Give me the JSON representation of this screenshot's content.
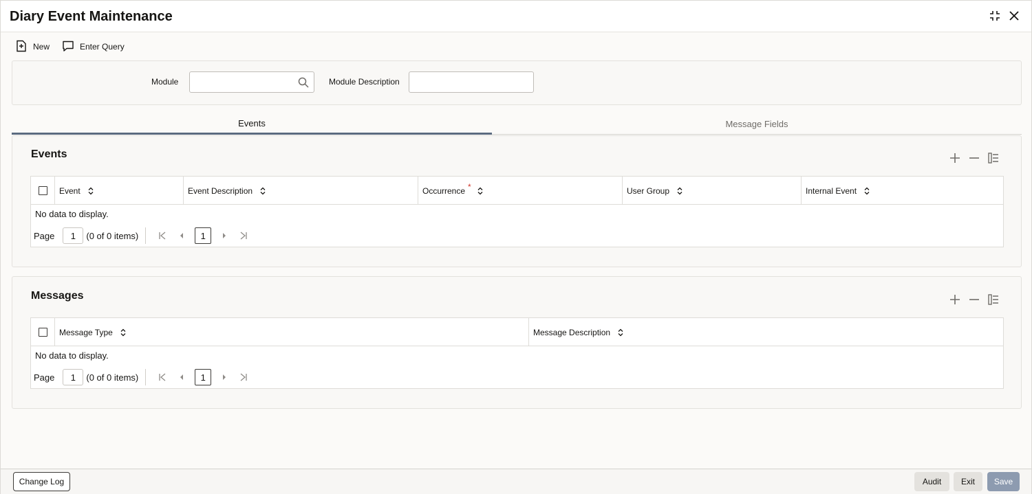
{
  "window": {
    "title": "Diary Event Maintenance"
  },
  "toolbar": {
    "new_label": "New",
    "enter_query_label": "Enter Query"
  },
  "form": {
    "module_label": "Module",
    "module_value": "",
    "module_description_label": "Module Description",
    "module_description_value": ""
  },
  "tabs": [
    {
      "label": "Events",
      "active": true
    },
    {
      "label": "Message Fields",
      "active": false
    }
  ],
  "events": {
    "title": "Events",
    "columns": [
      "Event",
      "Event Description",
      "Occurrence",
      "User Group",
      "Internal Event"
    ],
    "occurrence_required": "*",
    "empty_text": "No data to display.",
    "pager": {
      "label": "Page",
      "page": "1",
      "summary": "(0 of 0 items)",
      "current": "1"
    }
  },
  "messages": {
    "title": "Messages",
    "columns": [
      "Message Type",
      "Message Description"
    ],
    "empty_text": "No data to display.",
    "pager": {
      "label": "Page",
      "page": "1",
      "summary": "(0 of 0 items)",
      "current": "1"
    }
  },
  "footer": {
    "change_log_label": "Change Log",
    "audit_label": "Audit",
    "exit_label": "Exit",
    "save_label": "Save"
  },
  "icons": {
    "maximize": "maximize-icon",
    "close": "close-icon",
    "new": "new-document-icon",
    "enter_query": "chat-bubble-icon",
    "search": "search-icon",
    "add": "plus-icon",
    "remove": "minus-icon",
    "columns": "column-list-icon",
    "sort": "sort-icon"
  },
  "colors": {
    "primary_button": "#8d9bb0",
    "active_tab": "#5b6b80",
    "required": "#d0372c"
  }
}
